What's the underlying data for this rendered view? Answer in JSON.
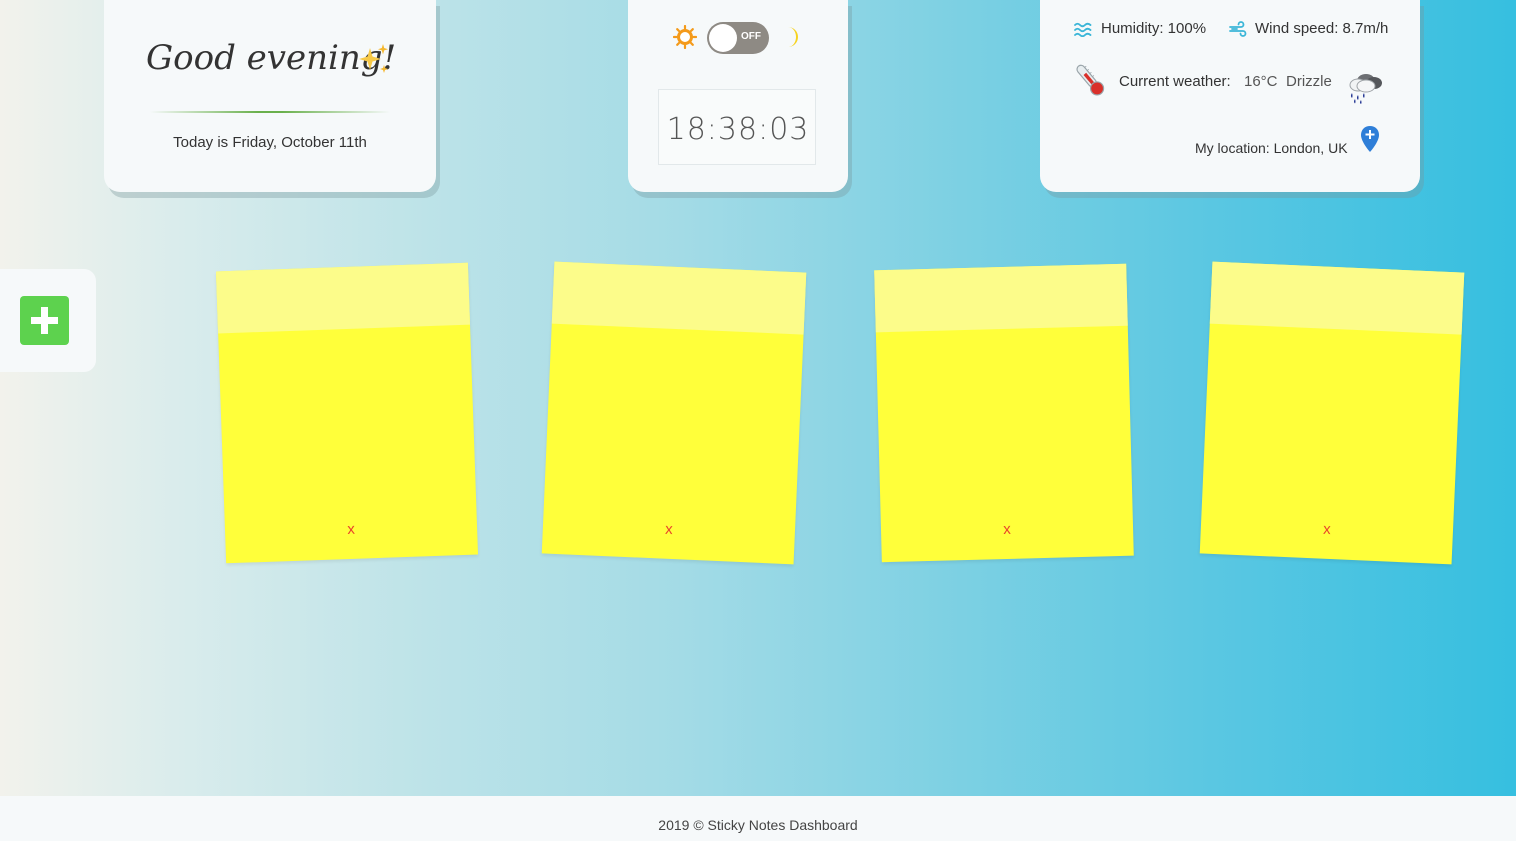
{
  "greeting": {
    "title": "Good evening!",
    "icon": "sparkles-icon",
    "date": "Today is Friday, October 11th"
  },
  "theme": {
    "toggle_state": "OFF",
    "icons": [
      "sun-icon",
      "moon-icon"
    ]
  },
  "clock": {
    "time": "18:38:03"
  },
  "weather": {
    "humidity": "Humidity: 100%",
    "wind": "Wind speed: 8.7m/h",
    "current_label": "Current weather:",
    "temperature": "16°C",
    "condition": "Drizzle",
    "location": "My location: London, UK",
    "icons": [
      "humidity-icon",
      "wind-icon",
      "thermometer-icon",
      "drizzle-icon",
      "location-pin-icon"
    ]
  },
  "sidebar": {
    "add_button_icon": "plus-icon",
    "add_button_color": "#5dd24e"
  },
  "notes": [
    {
      "delete_label": "x",
      "color": "#ffff3a"
    },
    {
      "delete_label": "x",
      "color": "#ffff3a"
    },
    {
      "delete_label": "x",
      "color": "#ffff3a"
    },
    {
      "delete_label": "x",
      "color": "#ffff3a"
    }
  ],
  "footer": {
    "text": "2019 © Sticky Notes Dashboard"
  }
}
